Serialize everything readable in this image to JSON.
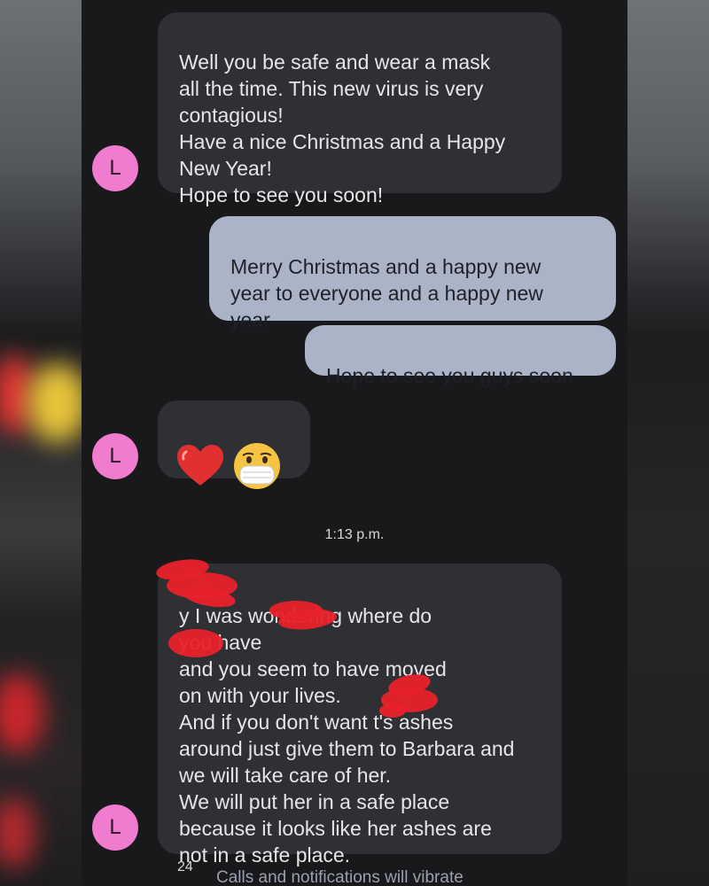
{
  "conversation": {
    "messages": [
      {
        "sender": "incoming",
        "avatar_letter": "L",
        "text": "Well you be safe and wear a mask\nall the time. This new virus is very\ncontagious!\nHave a nice Christmas and a Happy\nNew Year!\nHope to see you soon!"
      },
      {
        "sender": "outgoing",
        "text": "Merry Christmas and a happy new\nyear to everyone and a happy new\nyear"
      },
      {
        "sender": "outgoing",
        "text": "Hope to see you guys soon"
      },
      {
        "sender": "incoming",
        "avatar_letter": "L",
        "emojis": [
          "heart-emoji",
          "mask-face-emoji"
        ]
      },
      {
        "sender": "incoming",
        "avatar_letter": "L",
        "text": "y I was wondering where do\nyou have\n   and you seem to have moved\non with your lives.\nAnd if you don't want       t's ashes\naround just give them to Barbara and\nwe will take care of her.\nWe will put her in a safe place\nbecause it looks like her ashes are\nnot in a safe place."
      }
    ],
    "timestamp": "1:13 p.m."
  },
  "footer": {
    "count": "24",
    "notice": "Calls and notifications will vibrate"
  },
  "colors": {
    "incoming_bubble": "#2f3034",
    "outgoing_bubble": "#aab4c6",
    "avatar": "#f07ccf",
    "redaction": "#e8212b"
  }
}
